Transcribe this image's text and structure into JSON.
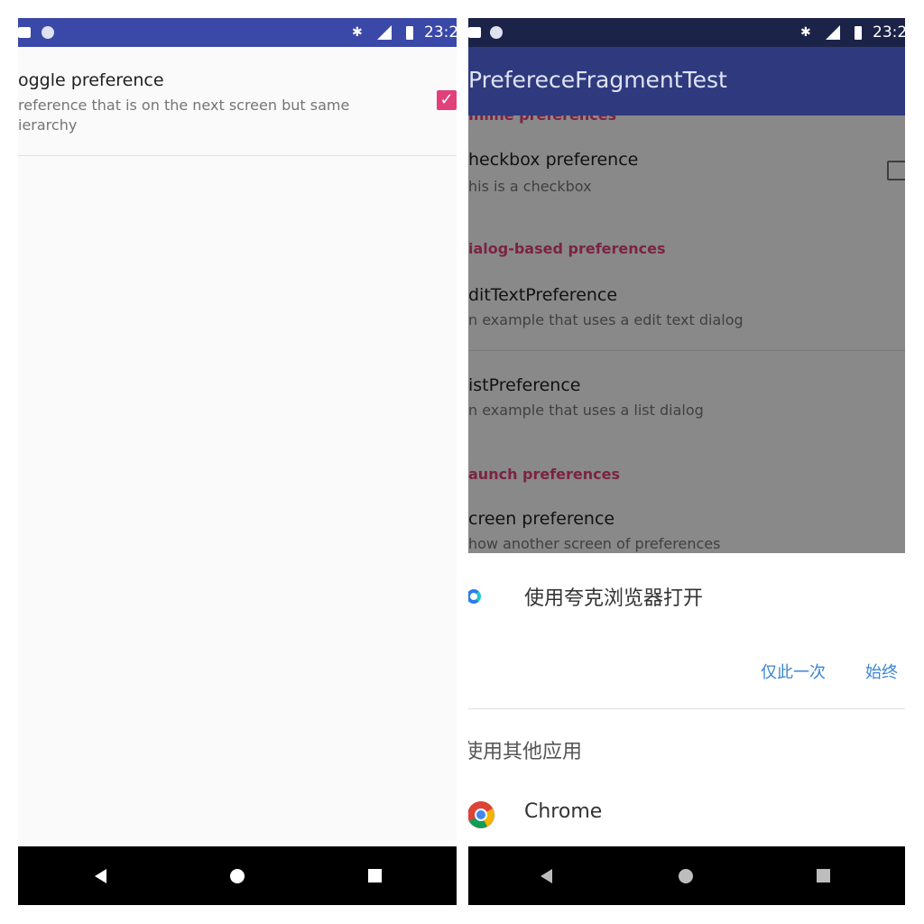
{
  "left": {
    "status_time": "23:2",
    "pref_title": "oggle preference",
    "pref_summary": "reference that is on the next screen but same ierarchy",
    "checkbox_checked": true
  },
  "right": {
    "status_time": "23:2",
    "app_title": "PrefereceFragmentTest",
    "category_inline": "Inline preferences",
    "checkbox_title": "heckbox preference",
    "checkbox_summary": "his is a checkbox",
    "category_dialog": "ialog-based preferences",
    "edittext_title": "ditTextPreference",
    "edittext_summary": "n example that uses a edit text dialog",
    "list_title": "istPreference",
    "list_summary": "n example that uses a list dialog",
    "category_launch": "aunch preferences",
    "screen_title": "creen preference",
    "screen_summary": "how another screen of preferences",
    "sheet": {
      "open_with": "使用夸克浏览器打开",
      "just_once": "仅此一次",
      "always": "始终",
      "use_other": "使用其他应用",
      "chrome_label": "Chrome"
    }
  },
  "colors": {
    "accent_pink": "#e0417b",
    "link_blue": "#3b86d6",
    "statusbar_left": "#3a48a8",
    "appbar_right": "#2f3a7e"
  },
  "icons": [
    "notification-icon",
    "circle-icon",
    "bluetooth-icon",
    "lte-signal-icon",
    "battery-icon",
    "checkbox-checked-icon",
    "checkbox-unchecked-icon",
    "quark-browser-icon",
    "chrome-icon",
    "nav-back-icon",
    "nav-home-icon",
    "nav-recent-icon"
  ]
}
